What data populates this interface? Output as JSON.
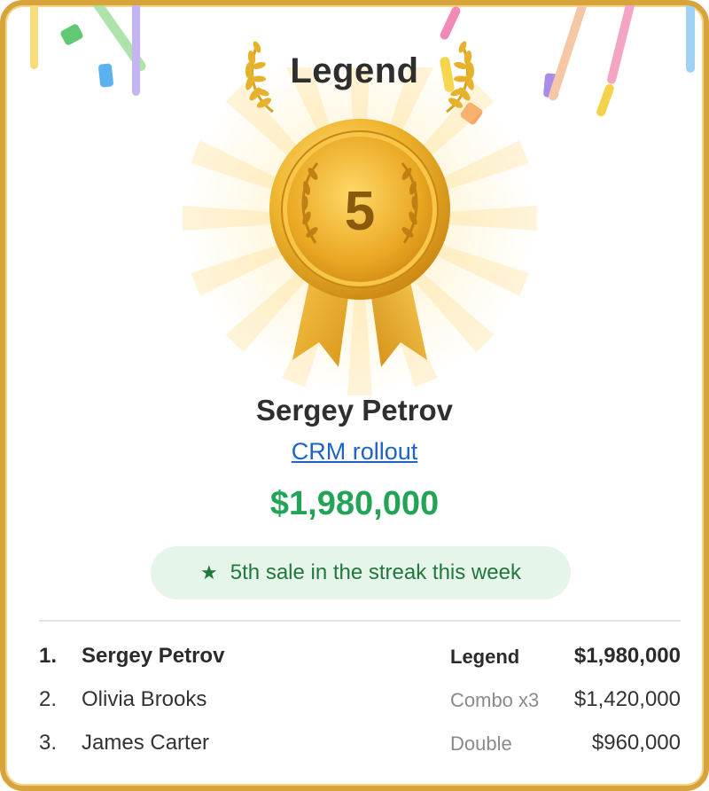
{
  "award": {
    "title": "Legend",
    "medal_number": "5",
    "winner_name": "Sergey Petrov",
    "deal_link": "CRM rollout",
    "amount": "$1,980,000",
    "streak_text": "5th sale in the streak this week"
  },
  "leaderboard": [
    {
      "rank": "1.",
      "name": "Sergey Petrov",
      "badge": "Legend",
      "value": "$1,980,000"
    },
    {
      "rank": "2.",
      "name": "Olivia Brooks",
      "badge": "Combo x3",
      "value": "$1,420,000"
    },
    {
      "rank": "3.",
      "name": "James Carter",
      "badge": "Double",
      "value": "$960,000"
    }
  ],
  "colors": {
    "frame_gold": "#d7a33a",
    "amount_green": "#22a356",
    "link_blue": "#1f63c5",
    "streak_bg": "#e6f5ea",
    "streak_text": "#23763e"
  }
}
